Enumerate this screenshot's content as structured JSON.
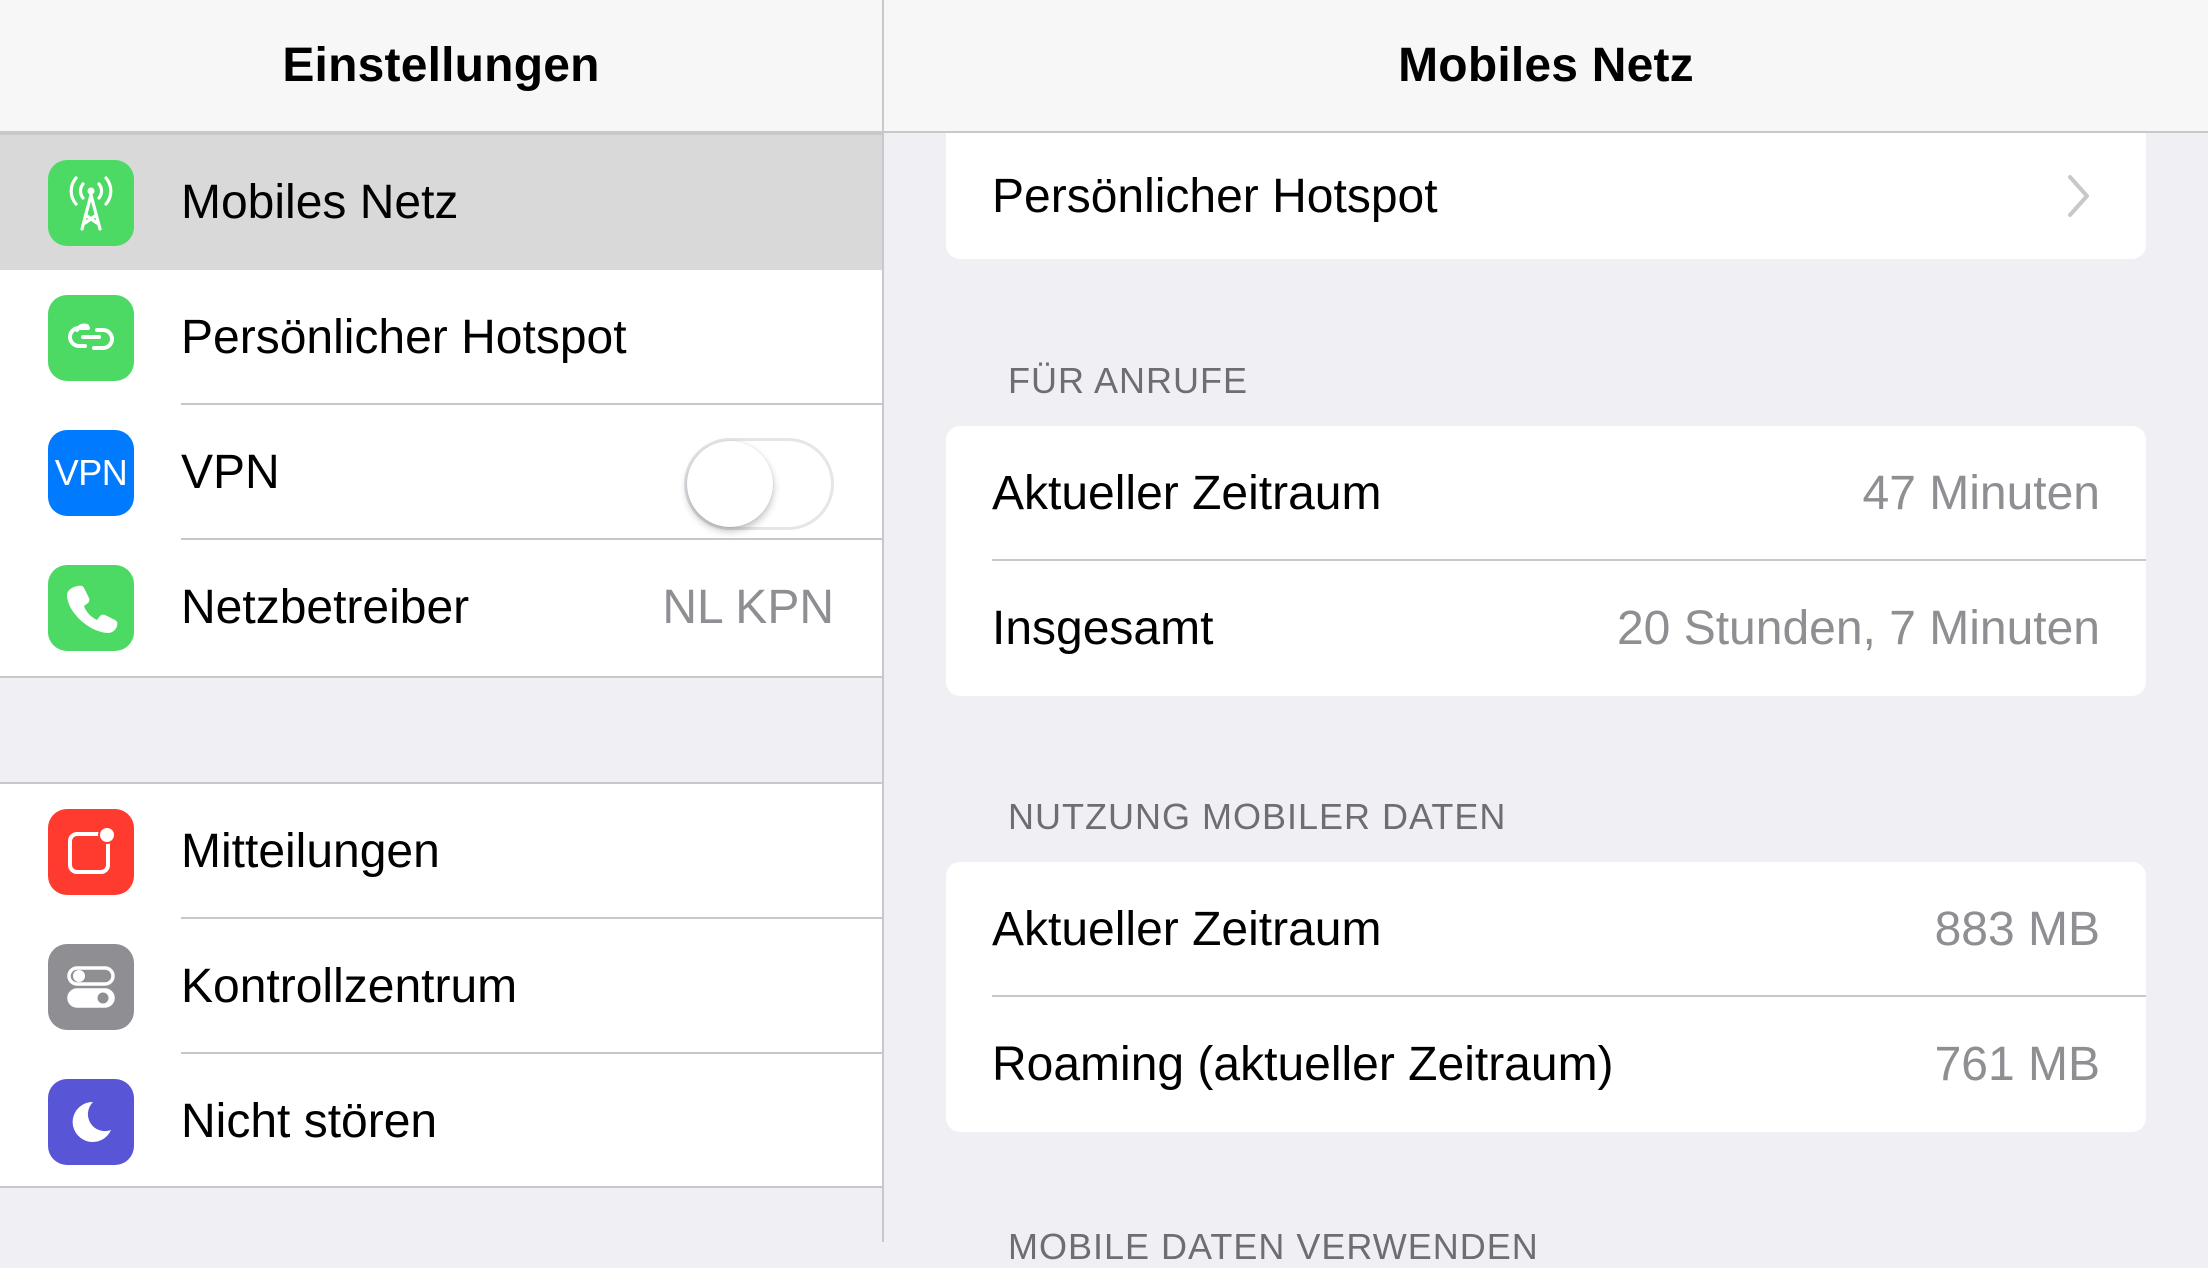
{
  "left": {
    "title": "Einstellungen",
    "group1": [
      {
        "label": "Mobiles Netz",
        "icon": "cellular-antenna-icon",
        "color": "#4cd964",
        "selected": true
      },
      {
        "label": "Persönlicher Hotspot",
        "icon": "hotspot-link-icon",
        "color": "#4cd964"
      },
      {
        "label": "VPN",
        "icon": "vpn-icon",
        "icon_text": "VPN",
        "color": "#007aff",
        "toggle": "off"
      },
      {
        "label": "Netzbetreiber",
        "icon": "phone-icon",
        "color": "#4cd964",
        "detail": "NL KPN"
      }
    ],
    "group2": [
      {
        "label": "Mitteilungen",
        "icon": "notifications-icon",
        "color": "#ff3b30"
      },
      {
        "label": "Kontrollzentrum",
        "icon": "control-center-icon",
        "color": "#8e8e93"
      },
      {
        "label": "Nicht stören",
        "icon": "moon-icon",
        "color": "#5856d6"
      }
    ]
  },
  "right": {
    "title": "Mobiles Netz",
    "hotspot_label": "Persönlicher Hotspot",
    "calls_header": "FÜR ANRUFE",
    "calls": [
      {
        "label": "Aktueller Zeitraum",
        "value": "47 Minuten"
      },
      {
        "label": "Insgesamt",
        "value": "20 Stunden, 7 Minuten"
      }
    ],
    "data_header": "NUTZUNG MOBILER DATEN",
    "data": [
      {
        "label": "Aktueller Zeitraum",
        "value": "883 MB"
      },
      {
        "label": "Roaming (aktueller Zeitraum)",
        "value": "761 MB"
      }
    ],
    "next_header": "MOBILE DATEN VERWENDEN"
  }
}
